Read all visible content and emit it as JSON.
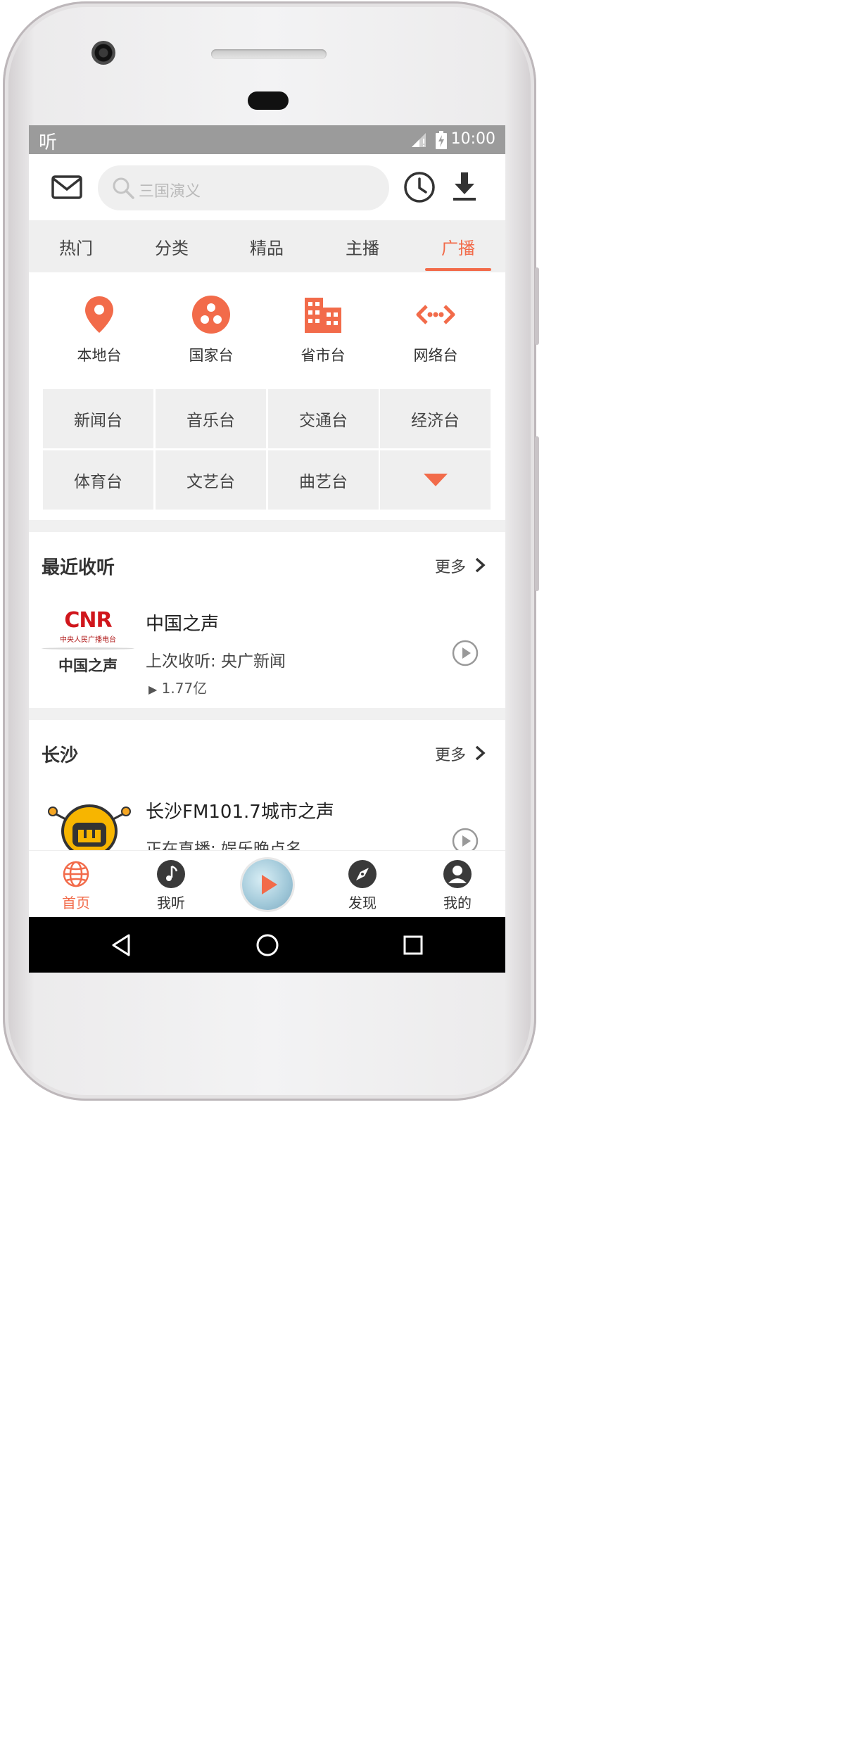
{
  "status_bar": {
    "app_glyph": "听",
    "time": "10:00"
  },
  "search": {
    "placeholder": "三国演义"
  },
  "tabs": [
    {
      "label": "热门"
    },
    {
      "label": "分类"
    },
    {
      "label": "精品"
    },
    {
      "label": "主播"
    },
    {
      "label": "广播",
      "active": true
    }
  ],
  "categories": [
    {
      "label": "本地台",
      "icon": "location-pin-icon"
    },
    {
      "label": "国家台",
      "icon": "dots-circle-icon"
    },
    {
      "label": "省市台",
      "icon": "building-icon"
    },
    {
      "label": "网络台",
      "icon": "network-icon"
    }
  ],
  "genres": [
    "新闻台",
    "音乐台",
    "交通台",
    "经济台",
    "体育台",
    "文艺台",
    "曲艺台"
  ],
  "recent": {
    "title": "最近收听",
    "more": "更多",
    "item": {
      "logo_text": "CNR",
      "logo_sub": "中央人民广播电台",
      "logo_name": "中国之声",
      "name": "中国之声",
      "last": "上次收听: 央广新闻",
      "plays": "1.77亿"
    }
  },
  "local": {
    "title": "长沙",
    "more": "更多",
    "item": {
      "name": "长沙FM101.7城市之声",
      "live": "正在直播: 娱乐晚点名"
    }
  },
  "bottom_nav": [
    {
      "label": "首页",
      "active": true
    },
    {
      "label": "我听"
    },
    {
      "label": "发现"
    },
    {
      "label": "我的"
    }
  ],
  "colors": {
    "accent": "#f26b4a",
    "statusbar": "#9b9b9b"
  }
}
